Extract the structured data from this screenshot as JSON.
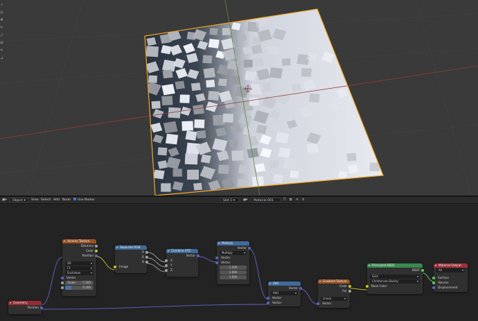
{
  "header": {
    "mode": "Object",
    "menus": [
      "View",
      "Select",
      "Add",
      "Node"
    ],
    "use_nodes": "Use Nodes",
    "slot": "Slot 1",
    "material": "Material.001"
  },
  "nodes": {
    "geometry": {
      "title": "Geometry",
      "outputs": [
        "Position"
      ]
    },
    "voronoi": {
      "title": "Voronoi Texture",
      "outputs": [
        "Distance",
        "Color",
        "Position"
      ],
      "dim": "2D",
      "feature": "F1",
      "metric": "Euclidean",
      "vector_label": "Vector",
      "scale_label": "Scale",
      "scale_value": "7.300",
      "random_value": "0.206"
    },
    "separate": {
      "title": "Separate RGB",
      "outputs": [
        "R",
        "G",
        "B"
      ],
      "inputs": [
        "Image"
      ]
    },
    "combine": {
      "title": "Combine XYZ",
      "outputs": [
        "Vector"
      ],
      "inputs": [
        "X",
        "Y",
        "Z"
      ]
    },
    "multiply": {
      "title": "Multiply",
      "outputs": [
        "Vector"
      ],
      "op": "Multiply",
      "inputs": [
        "Vector",
        "Vector"
      ],
      "values": [
        "1.100",
        "1.000",
        "1.000"
      ]
    },
    "add": {
      "title": "Add",
      "outputs": [
        "Vector"
      ],
      "op": "Add",
      "inputs": [
        "Vector",
        "Vector"
      ]
    },
    "gradient": {
      "title": "Gradient Texture",
      "outputs": [
        "Color",
        "Fac"
      ],
      "type": "Linear",
      "inputs": [
        "Vector"
      ]
    },
    "bsdf": {
      "title": "Principled BSDF",
      "outputs": [
        "BSDF"
      ],
      "distribution": "GGX",
      "subsurface": "Christensen-Burley",
      "inputs": [
        "Base Color"
      ]
    },
    "output": {
      "title": "Material Output",
      "target": "All",
      "inputs": [
        "Surface",
        "Volume",
        "Displacement"
      ]
    }
  },
  "colors": {
    "texture_header": "#9b5226",
    "converter_header": "#3f6b9c",
    "shader_header": "#3a8a50",
    "output_header": "#a1303a",
    "selection": "#f5a623"
  }
}
